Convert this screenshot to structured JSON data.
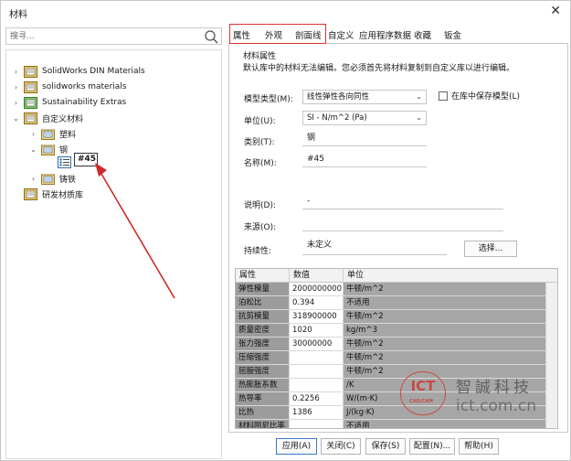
{
  "window": {
    "title": "材料"
  },
  "search": {
    "placeholder": "搜寻..."
  },
  "tree": {
    "items": [
      {
        "label": "SolidWorks DIN Materials"
      },
      {
        "label": "solidworks materials"
      },
      {
        "label": "Sustainability Extras"
      },
      {
        "label": "自定义材料"
      },
      {
        "label": "塑料"
      },
      {
        "label": "钢"
      },
      {
        "label": "#45"
      },
      {
        "label": "铸铁"
      },
      {
        "label": "研发材质库"
      }
    ]
  },
  "tabs": [
    "属性",
    "外观",
    "剖面线",
    "自定义",
    "应用程序数据",
    "收藏",
    "钣金"
  ],
  "props": {
    "section_title": "材料属性",
    "notice": "默认库中的材料无法编辑。您必须首先将材料复制到自定义库以进行编辑。",
    "model_type_label": "模型类型(M):",
    "model_type_value": "线性弹性各向同性",
    "save_model_label": "在库中保存模型(L)",
    "units_label": "单位(U):",
    "units_value": "SI - N/m^2 (Pa)",
    "category_label": "类别(T):",
    "category_value": "钢",
    "name_label": "名称(M):",
    "name_value": "#45",
    "description_label": "说明(D):",
    "description_value": "-",
    "source_label": "来源(O):",
    "source_value": "",
    "sustainability_label": "持续性:",
    "sustainability_value": "未定义",
    "select_button": "选择..."
  },
  "table": {
    "headers": [
      "属性",
      "数值",
      "单位"
    ],
    "rows": [
      {
        "name": "弹性模量",
        "value": "2000000000",
        "unit": "牛顿/m^2"
      },
      {
        "name": "泊松比",
        "value": "0.394",
        "unit": "不适用"
      },
      {
        "name": "抗剪模量",
        "value": "318900000",
        "unit": "牛顿/m^2"
      },
      {
        "name": "质量密度",
        "value": "1020",
        "unit": "kg/m^3"
      },
      {
        "name": "张力强度",
        "value": "30000000",
        "unit": "牛顿/m^2"
      },
      {
        "name": "压缩强度",
        "value": "",
        "unit": "牛顿/m^2"
      },
      {
        "name": "屈服强度",
        "value": "",
        "unit": "牛顿/m^2"
      },
      {
        "name": "热膨胀系数",
        "value": "",
        "unit": "/K"
      },
      {
        "name": "热导率",
        "value": "0.2256",
        "unit": "W/(m·K)"
      },
      {
        "name": "比热",
        "value": "1386",
        "unit": "J/(kg·K)"
      },
      {
        "name": "材料阻尼比率",
        "value": "",
        "unit": "不适用"
      }
    ]
  },
  "footer": {
    "apply": "应用(A)",
    "close": "关闭(C)",
    "save": "保存(S)",
    "config": "配置(N)...",
    "help": "帮助(H)"
  },
  "watermark": {
    "logo": "ICT",
    "logo_sub": "CAD/CAM",
    "company": "智誠科技",
    "url": "ict.com.cn"
  },
  "colors": {
    "highlight_red": "#e03030",
    "table_name_bg": "#9c9c9c",
    "table_unit_bg": "#a6a6a6",
    "folder_blue": "#2b6cb0",
    "library_green": "#3a9a3a"
  }
}
